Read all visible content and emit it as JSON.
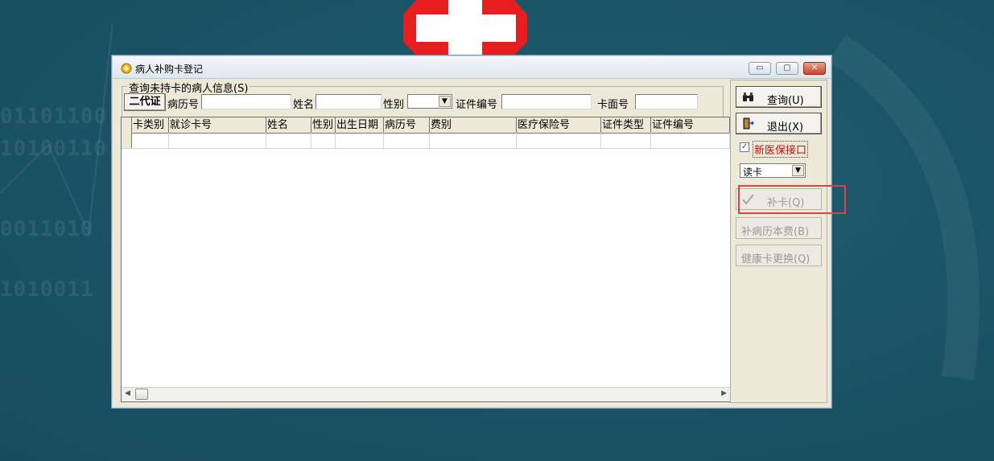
{
  "background": {
    "color": "#1a5567",
    "cross_color": "#e81e1e"
  },
  "window": {
    "title": "病人补购卡登记",
    "controls": {
      "minimize": "▭",
      "restore": "▢",
      "close": "✕"
    }
  },
  "query": {
    "group_label": "查询未持卡的病人信息(S)",
    "id_button": "二代证",
    "fields": {
      "record_no_label": "病历号",
      "name_label": "姓名",
      "gender_label": "性别",
      "id_no_label": "证件编号",
      "card_face_label": "卡面号",
      "record_no_value": "",
      "name_value": "",
      "gender_value": "",
      "id_no_value": "",
      "card_face_value": ""
    }
  },
  "grid": {
    "columns": [
      "卡类别",
      "就诊卡号",
      "姓名",
      "性别",
      "出生日期",
      "病历号",
      "费别",
      "医疗保险号",
      "证件类型",
      "证件编号"
    ]
  },
  "side": {
    "query_button": "查询(U)",
    "exit_button": "退出(X)",
    "checkbox_label": "新医保接口",
    "checkbox_checked": true,
    "read_mode": "读卡",
    "replace_card_button": "补卡(Q)",
    "record_fee_button": "补病历本费(B)",
    "health_card_button": "健康卡更换(Q)"
  }
}
